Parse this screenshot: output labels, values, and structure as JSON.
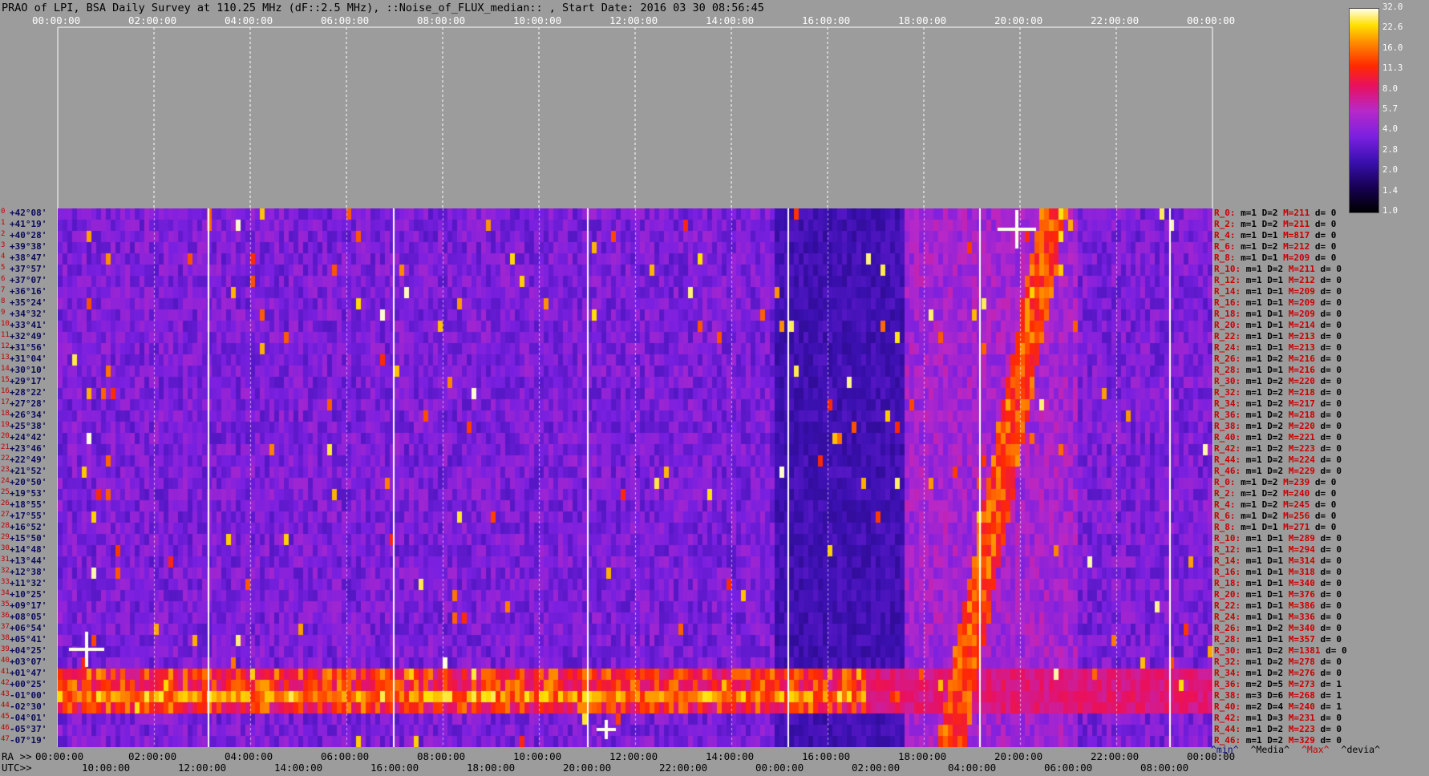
{
  "title": "PRAO of LPI, BSA Daily Survey at 110.25 MHz (dF::2.5 MHz), ::Noise_of_FLUX_median:: , Start Date: 2016 03 30 08:56:45",
  "top_axis": {
    "labels": [
      "00:00:00",
      "02:00:00",
      "04:00:00",
      "06:00:00",
      "08:00:00",
      "10:00:00",
      "12:00:00",
      "14:00:00",
      "16:00:00",
      "18:00:00",
      "20:00:00",
      "22:00:00",
      "00:00:00"
    ]
  },
  "bottom_axis": {
    "ra_label": "RA >>",
    "ra_labels": [
      "00:00:00",
      "02:00:00",
      "04:00:00",
      "06:00:00",
      "08:00:00",
      "10:00:00",
      "12:00:00",
      "14:00:00",
      "16:00:00",
      "18:00:00",
      "20:00:00",
      "22:00:00",
      "00:00:00"
    ],
    "utc_label": "UTC>>",
    "utc_labels": [
      "10:00:00",
      "12:00:00",
      "14:00:00",
      "16:00:00",
      "18:00:00",
      "20:00:00",
      "22:00:00",
      "00:00:00",
      "02:00:00",
      "04:00:00",
      "06:00:00",
      "08:00:00"
    ]
  },
  "colorbar": {
    "ticks": [
      "32.0",
      "22.6",
      "16.0",
      "11.3",
      "8.0",
      "5.7",
      "4.0",
      "2.8",
      "2.0",
      "1.4",
      "1.0"
    ]
  },
  "legend": {
    "min": "^min^",
    "median": "^Media^",
    "max": "^Max^",
    "dev": "^devia^",
    "min_color": "#0a0a8a",
    "median_color": "#000000",
    "max_color": "#cc0000",
    "dev_color": "#000000"
  },
  "chart_data": {
    "type": "heatmap",
    "title": "PRAO of LPI, BSA Daily Survey at 110.25 MHz (dF::2.5 MHz), ::Noise_of_FLUX_median:: , Start Date: 2016 03 30 08:56:45",
    "x_axis_top": "RA 00:00:00 - 24:00:00",
    "colorscale_range": [
      1.0,
      32.0
    ],
    "colorscale": "log",
    "declinations": [
      "+42°08'",
      "+41°19'",
      "+40°28'",
      "+39°38'",
      "+38°47'",
      "+37°57'",
      "+37°07'",
      "+36°16'",
      "+35°24'",
      "+34°32'",
      "+33°41'",
      "+32°49'",
      "+31°56'",
      "+31°04'",
      "+30°10'",
      "+29°17'",
      "+28°22'",
      "+27°28'",
      "+26°34'",
      "+25°38'",
      "+24°42'",
      "+23°46'",
      "+22°49'",
      "+21°52'",
      "+20°50'",
      "+19°53'",
      "+18°55'",
      "+17°55'",
      "+16°52'",
      "+15°50'",
      "+14°48'",
      "+13°44'",
      "+12°38'",
      "+11°32'",
      "+10°25'",
      "+09°17'",
      "+08°05'",
      "+06°54'",
      "+05°41'",
      "+04°25'",
      "+03°07'",
      "+01°47'",
      "+00°25'",
      "-01°00'",
      "-02°30'",
      "-04°01'",
      "-05°37'",
      "-07°19'"
    ],
    "row_stats": [
      {
        "r": "R_0:",
        "min": "m=1",
        "dev": "D=2",
        "max": "M=211",
        "d": "d= 0"
      },
      {
        "r": "R_2:",
        "min": "m=1",
        "dev": "D=2",
        "max": "M=211",
        "d": "d= 0"
      },
      {
        "r": "R_4:",
        "min": "m=1",
        "dev": "D=1",
        "max": "M=817",
        "d": "d= 0"
      },
      {
        "r": "R_6:",
        "min": "m=1",
        "dev": "D=2",
        "max": "M=212",
        "d": "d= 0"
      },
      {
        "r": "R_8:",
        "min": "m=1",
        "dev": "D=1",
        "max": "M=209",
        "d": "d= 0"
      },
      {
        "r": "R_10:",
        "min": "m=1",
        "dev": "D=2",
        "max": "M=211",
        "d": "d= 0"
      },
      {
        "r": "R_12:",
        "min": "m=1",
        "dev": "D=1",
        "max": "M=212",
        "d": "d= 0"
      },
      {
        "r": "R_14:",
        "min": "m=1",
        "dev": "D=1",
        "max": "M=209",
        "d": "d= 0"
      },
      {
        "r": "R_16:",
        "min": "m=1",
        "dev": "D=1",
        "max": "M=209",
        "d": "d= 0"
      },
      {
        "r": "R_18:",
        "min": "m=1",
        "dev": "D=1",
        "max": "M=209",
        "d": "d= 0"
      },
      {
        "r": "R_20:",
        "min": "m=1",
        "dev": "D=1",
        "max": "M=214",
        "d": "d= 0"
      },
      {
        "r": "R_22:",
        "min": "m=1",
        "dev": "D=1",
        "max": "M=213",
        "d": "d= 0"
      },
      {
        "r": "R_24:",
        "min": "m=1",
        "dev": "D=1",
        "max": "M=213",
        "d": "d= 0"
      },
      {
        "r": "R_26:",
        "min": "m=1",
        "dev": "D=2",
        "max": "M=216",
        "d": "d= 0"
      },
      {
        "r": "R_28:",
        "min": "m=1",
        "dev": "D=1",
        "max": "M=216",
        "d": "d= 0"
      },
      {
        "r": "R_30:",
        "min": "m=1",
        "dev": "D=2",
        "max": "M=220",
        "d": "d= 0"
      },
      {
        "r": "R_32:",
        "min": "m=1",
        "dev": "D=2",
        "max": "M=218",
        "d": "d= 0"
      },
      {
        "r": "R_34:",
        "min": "m=1",
        "dev": "D=2",
        "max": "M=217",
        "d": "d= 0"
      },
      {
        "r": "R_36:",
        "min": "m=1",
        "dev": "D=2",
        "max": "M=218",
        "d": "d= 0"
      },
      {
        "r": "R_38:",
        "min": "m=1",
        "dev": "D=2",
        "max": "M=220",
        "d": "d= 0"
      },
      {
        "r": "R_40:",
        "min": "m=1",
        "dev": "D=2",
        "max": "M=221",
        "d": "d= 0"
      },
      {
        "r": "R_42:",
        "min": "m=1",
        "dev": "D=2",
        "max": "M=223",
        "d": "d= 0"
      },
      {
        "r": "R_44:",
        "min": "m=1",
        "dev": "D=2",
        "max": "M=224",
        "d": "d= 0"
      },
      {
        "r": "R_46:",
        "min": "m=1",
        "dev": "D=2",
        "max": "M=229",
        "d": "d= 0"
      },
      {
        "r": "R_0:",
        "min": "m=1",
        "dev": "D=2",
        "max": "M=239",
        "d": "d= 0"
      },
      {
        "r": "R_2:",
        "min": "m=1",
        "dev": "D=2",
        "max": "M=240",
        "d": "d= 0"
      },
      {
        "r": "R_4:",
        "min": "m=1",
        "dev": "D=2",
        "max": "M=245",
        "d": "d= 0"
      },
      {
        "r": "R_6:",
        "min": "m=1",
        "dev": "D=2",
        "max": "M=256",
        "d": "d= 0"
      },
      {
        "r": "R_8:",
        "min": "m=1",
        "dev": "D=1",
        "max": "M=271",
        "d": "d= 0"
      },
      {
        "r": "R_10:",
        "min": "m=1",
        "dev": "D=1",
        "max": "M=289",
        "d": "d= 0"
      },
      {
        "r": "R_12:",
        "min": "m=1",
        "dev": "D=1",
        "max": "M=294",
        "d": "d= 0"
      },
      {
        "r": "R_14:",
        "min": "m=1",
        "dev": "D=1",
        "max": "M=314",
        "d": "d= 0"
      },
      {
        "r": "R_16:",
        "min": "m=1",
        "dev": "D=1",
        "max": "M=318",
        "d": "d= 0"
      },
      {
        "r": "R_18:",
        "min": "m=1",
        "dev": "D=1",
        "max": "M=340",
        "d": "d= 0"
      },
      {
        "r": "R_20:",
        "min": "m=1",
        "dev": "D=1",
        "max": "M=376",
        "d": "d= 0"
      },
      {
        "r": "R_22:",
        "min": "m=1",
        "dev": "D=1",
        "max": "M=386",
        "d": "d= 0"
      },
      {
        "r": "R_24:",
        "min": "m=1",
        "dev": "D=1",
        "max": "M=336",
        "d": "d= 0"
      },
      {
        "r": "R_26:",
        "min": "m=1",
        "dev": "D=2",
        "max": "M=340",
        "d": "d= 0"
      },
      {
        "r": "R_28:",
        "min": "m=1",
        "dev": "D=1",
        "max": "M=357",
        "d": "d= 0"
      },
      {
        "r": "R_30:",
        "min": "m=1",
        "dev": "D=2",
        "max": "M=1381",
        "d": "d= 0"
      },
      {
        "r": "R_32:",
        "min": "m=1",
        "dev": "D=2",
        "max": "M=278",
        "d": "d= 0"
      },
      {
        "r": "R_34:",
        "min": "m=1",
        "dev": "D=2",
        "max": "M=276",
        "d": "d= 0"
      },
      {
        "r": "R_36:",
        "min": "m=2",
        "dev": "D=5",
        "max": "M=273",
        "d": "d= 1"
      },
      {
        "r": "R_38:",
        "min": "m=3",
        "dev": "D=6",
        "max": "M=268",
        "d": "d= 1"
      },
      {
        "r": "R_40:",
        "min": "m=2",
        "dev": "D=4",
        "max": "M=240",
        "d": "d= 1"
      },
      {
        "r": "R_42:",
        "min": "m=1",
        "dev": "D=3",
        "max": "M=231",
        "d": "d= 0"
      },
      {
        "r": "R_44:",
        "min": "m=1",
        "dev": "D=2",
        "max": "M=223",
        "d": "d= 0"
      },
      {
        "r": "R_46:",
        "min": "m=1",
        "dev": "D=2",
        "max": "M=329",
        "d": "d= 0"
      }
    ]
  }
}
